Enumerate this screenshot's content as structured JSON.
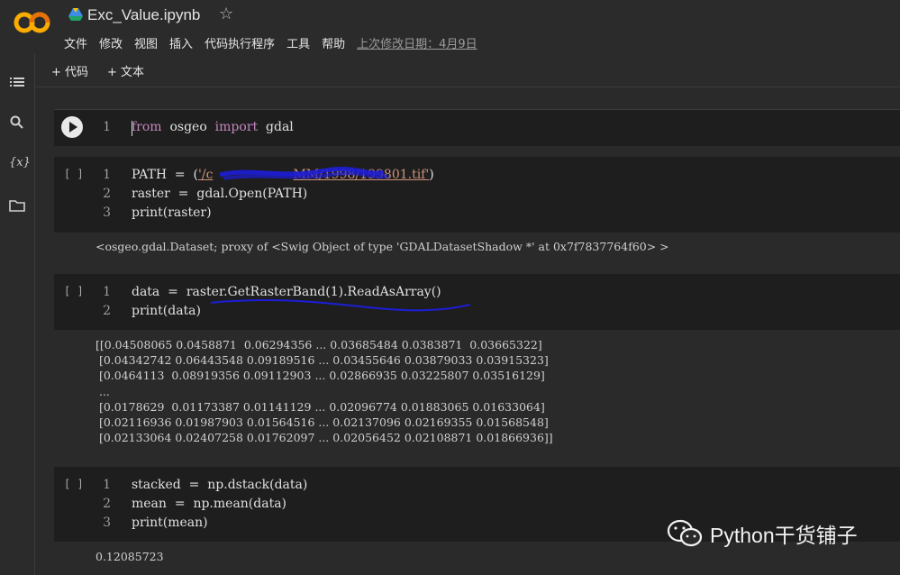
{
  "app": {
    "title": "Exc_Value.ipynb",
    "menu": [
      "文件",
      "修改",
      "视图",
      "插入",
      "代码执行程序",
      "工具",
      "帮助"
    ],
    "last_modified": "上次修改日期：4月9日"
  },
  "toolbar": {
    "add_code": "+ 代码",
    "add_text": "+ 文本"
  },
  "cells": [
    {
      "bracket": "",
      "lines": [
        {
          "n": "1",
          "parts": [
            [
              "kw",
              "from"
            ],
            [
              "",
              "  osgeo  "
            ],
            [
              "kw",
              "import"
            ],
            [
              "",
              "  gdal"
            ]
          ]
        }
      ]
    },
    {
      "bracket": "[ ]",
      "lines": [
        {
          "n": "1",
          "parts": [
            [
              "",
              "PATH  =  ("
            ],
            [
              "str",
              "'/c"
            ],
            [
              "str",
              "                    "
            ],
            [
              "str",
              "MM/1998/199801.tif'"
            ],
            [
              "",
              ")"
            ]
          ]
        },
        {
          "n": "2",
          "parts": [
            [
              "",
              "raster  =  gdal.Open(PATH)"
            ]
          ]
        },
        {
          "n": "3",
          "parts": [
            [
              "",
              "print(raster)"
            ]
          ]
        }
      ],
      "output": "<osgeo.gdal.Dataset; proxy of <Swig Object of type 'GDALDatasetShadow *' at 0x7f7837764f60> >"
    },
    {
      "bracket": "[ ]",
      "lines": [
        {
          "n": "1",
          "parts": [
            [
              "",
              "data  =  raster.GetRasterBand(1).ReadAsArray()"
            ]
          ]
        },
        {
          "n": "2",
          "parts": [
            [
              "",
              "print(data)"
            ]
          ]
        }
      ],
      "output": "[[0.04508065 0.0458871  0.06294356 ... 0.03685484 0.0383871  0.03665322]\n [0.04342742 0.06443548 0.09189516 ... 0.03455646 0.03879033 0.03915323]\n [0.0464113  0.08919356 0.09112903 ... 0.02866935 0.03225807 0.03516129]\n ...\n [0.0178629  0.01173387 0.01141129 ... 0.02096774 0.01883065 0.01633064]\n [0.02116936 0.01987903 0.01564516 ... 0.02137096 0.02169355 0.01568548]\n [0.02133064 0.02407258 0.01762097 ... 0.02056452 0.02108871 0.01866936]]"
    },
    {
      "bracket": "[ ]",
      "lines": [
        {
          "n": "1",
          "parts": [
            [
              "",
              "stacked  =  np.dstack(data)"
            ]
          ]
        },
        {
          "n": "2",
          "parts": [
            [
              "",
              "mean  =  np.mean(data)"
            ]
          ]
        },
        {
          "n": "3",
          "parts": [
            [
              "",
              "print(mean)"
            ]
          ]
        }
      ],
      "output": "0.12085723"
    }
  ],
  "watermark": {
    "text": "Python干货铺子"
  },
  "colors": {
    "keyword": "#c586c0",
    "string": "#ce9178",
    "scribble": "#1d1dd8"
  }
}
